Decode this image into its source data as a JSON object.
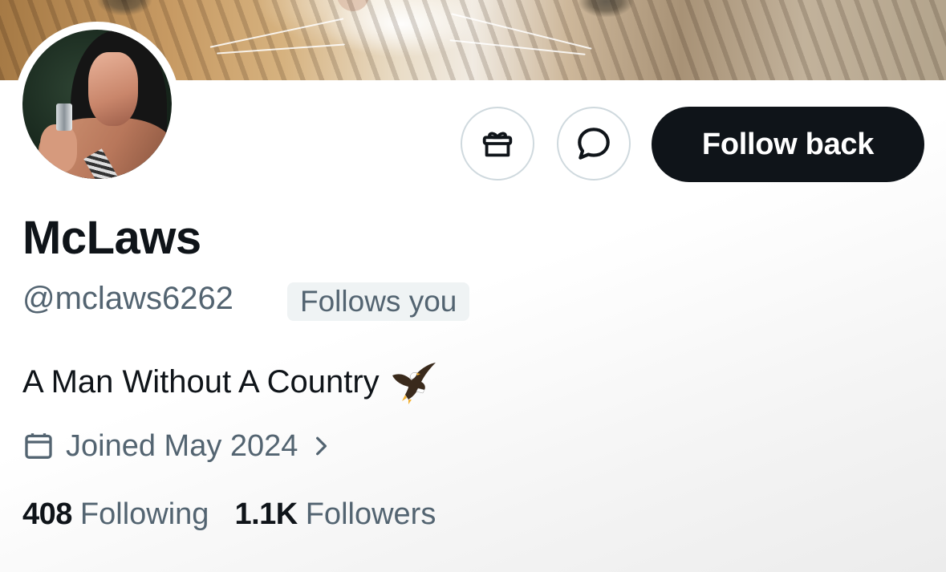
{
  "actions": {
    "follow_back_label": "Follow back"
  },
  "profile": {
    "display_name": "McLaws",
    "handle": "@mclaws6262",
    "follows_you_badge": "Follows you",
    "bio_text": "A Man Without A Country",
    "joined_text": "Joined May 2024"
  },
  "stats": {
    "following_count": "408",
    "following_label": "Following",
    "followers_count": "1.1K",
    "followers_label": "Followers"
  },
  "icons": {
    "gift": "gift-icon",
    "message": "message-icon",
    "calendar": "calendar-icon",
    "chevron": "chevron-right-icon",
    "bio_emoji": "eagle-emoji-icon"
  },
  "colors": {
    "primary_text": "#0f1419",
    "secondary_text": "#536471",
    "follow_button_bg": "#0f1419",
    "follow_button_text": "#ffffff",
    "badge_bg": "#eff3f4",
    "button_border": "#cfd9de"
  }
}
